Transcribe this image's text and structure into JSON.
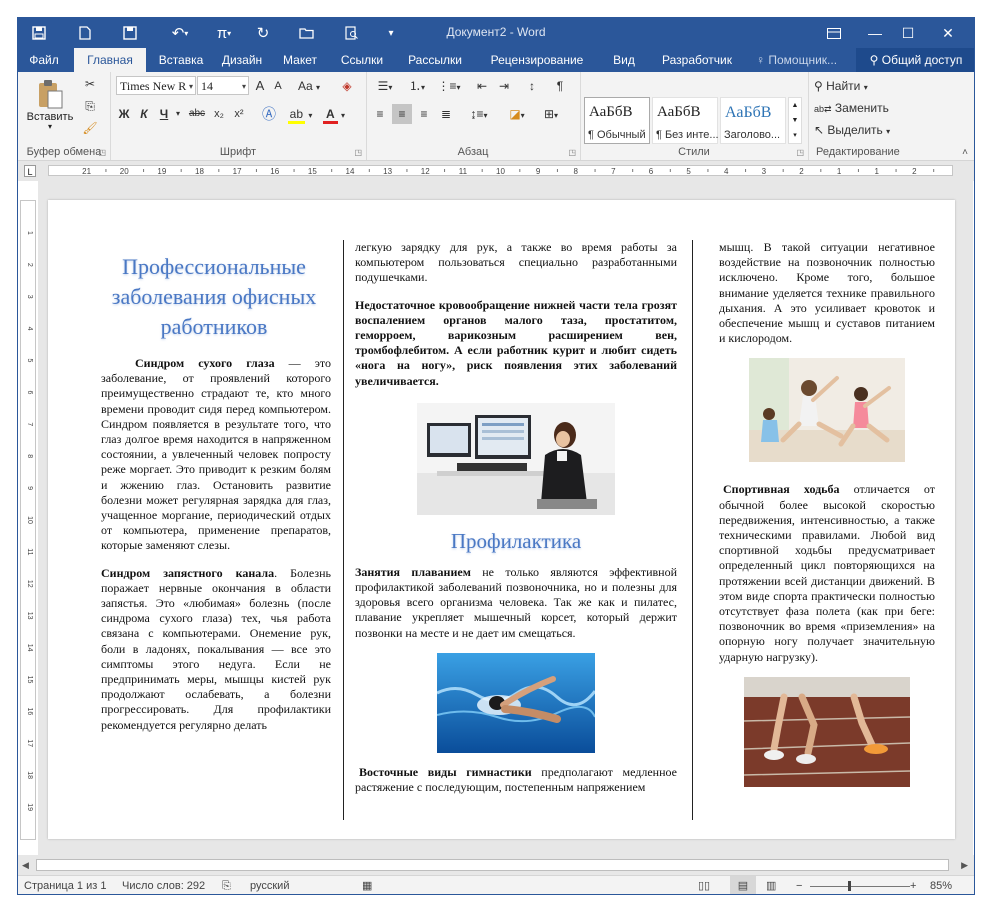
{
  "window": {
    "title": "Документ2 - Word"
  },
  "tabs": [
    "Файл",
    "Главная",
    "Вставка",
    "Дизайн",
    "Макет",
    "Ссылки",
    "Рассылки",
    "Рецензирование",
    "Вид",
    "Разработчик"
  ],
  "help": "Помощник...",
  "share": "Общий доступ",
  "ribbon": {
    "clipboard": {
      "label": "Буфер обмена",
      "paste": "Вставить"
    },
    "font": {
      "label": "Шрифт",
      "name": "Times New R",
      "size": "14",
      "bold": "Ж",
      "italic": "К",
      "underline": "Ч",
      "strike": "abc",
      "sub": "x₂",
      "sup": "x²",
      "grow": "A",
      "shrink": "A",
      "case": "Aa"
    },
    "paragraph": {
      "label": "Абзац"
    },
    "styles": {
      "label": "Стили",
      "items": [
        {
          "sample": "АаБбВ",
          "name": "¶ Обычный"
        },
        {
          "sample": "АаБбВ",
          "name": "¶ Без инте..."
        },
        {
          "sample": "АаБбВ",
          "name": "Заголово..."
        }
      ]
    },
    "editing": {
      "label": "Редактирование",
      "find": "Найти",
      "replace": "Заменить",
      "select": "Выделить"
    }
  },
  "ruler": {
    "h_labels": [
      "21",
      "20",
      "19",
      "18",
      "17",
      "16",
      "15",
      "14",
      "13",
      "12",
      "11",
      "10",
      "9",
      "8",
      "7",
      "6",
      "5",
      "4",
      "3",
      "2",
      "1",
      "1",
      "2"
    ],
    "v_labels": [
      "1",
      "2",
      "3",
      "4",
      "5",
      "6",
      "7",
      "8",
      "9",
      "10",
      "11",
      "12",
      "13",
      "14",
      "15",
      "16",
      "17",
      "18",
      "19"
    ]
  },
  "doc": {
    "col1": {
      "title": "Профессиональные заболевания офисных работников",
      "p1_bold": "Синдром сухого глаза",
      "p1_text": " — это заболевание, от проявлений которого преимущественно страдают те, кто много времени проводит сидя перед компьютером. Синдром появляется в результате того, что глаз долгое время находится в напряженном состоянии, а увлеченный человек попросту реже моргает. Это приводит к резким болям и жжению глаз. Остановить развитие болезни может регулярная зарядка для глаз, учащенное моргание, периодический отдых от компьютера, применение препаратов, которые заменяют слезы.",
      "p2_bold": "Синдром запястного канала",
      "p2_text": ". Болезнь поражает нервные окончания в области запястья. Это «любимая» болезнь (после синдрома сухого глаза) тех, чья работа связана с компьютерами. Онемение рук, боли в ладонях, покалывания — все это симптомы этого недуга. Если не предпринимать меры, мышцы кистей рук продолжают ослабевать, а болезни прогрессировать. Для профилактики рекомендуется регулярно делать"
    },
    "col2": {
      "p1": "легкую зарядку для рук, а также во время работы за компьютером пользоваться специально разработанными подушечками.",
      "p2_bold": "Недостаточное кровообращение нижней части тела грозят воспалением органов малого таза, простатитом, геморроем, варикозным расширением вен, тромбофлебитом. А если работник курит и любит сидеть «нога на ногу», риск появления этих заболеваний увеличивается.",
      "heading": "Профилактика",
      "p3_bold": "Занятия плаванием",
      "p3_text": " не только являются эффективной профилактикой заболеваний позвоночника, но и полезны для здоровья всего организма человека. Так же как и пилатес, плавание укрепляет мышечный корсет, который держит позвонки на месте и не дает им смещаться.",
      "p4_bold": "Восточные виды гимнастики",
      "p4_text": " предполагают медленное растяжение с последующим, постепенным напряжением"
    },
    "col3": {
      "p1": "мышц. В такой ситуации негативное воздействие на позвоночник полностью исключено. Кроме того, большое внимание уделяется технике правильного дыхания. А это усиливает кровоток и обеспечение мышц и суставов питанием и кислородом.",
      "p2_bold": "Спортивная ходьба",
      "p2_text": " отличается от обычной более высокой скоростью передвижения, интенсивностью, а также техническими правилами. Любой вид спортивной ходьбы предусматривает определенный цикл повторяющихся на протяжении всей дистанции движений. В этом виде спорта практически полностью отсутствует фаза полета (как при беге: позвоночник во время «приземления» на опорную ногу получает значительную ударную нагрузку)."
    }
  },
  "status": {
    "page": "Страница 1 из 1",
    "words": "Число слов: 292",
    "lang": "русский",
    "zoom": "85%"
  }
}
